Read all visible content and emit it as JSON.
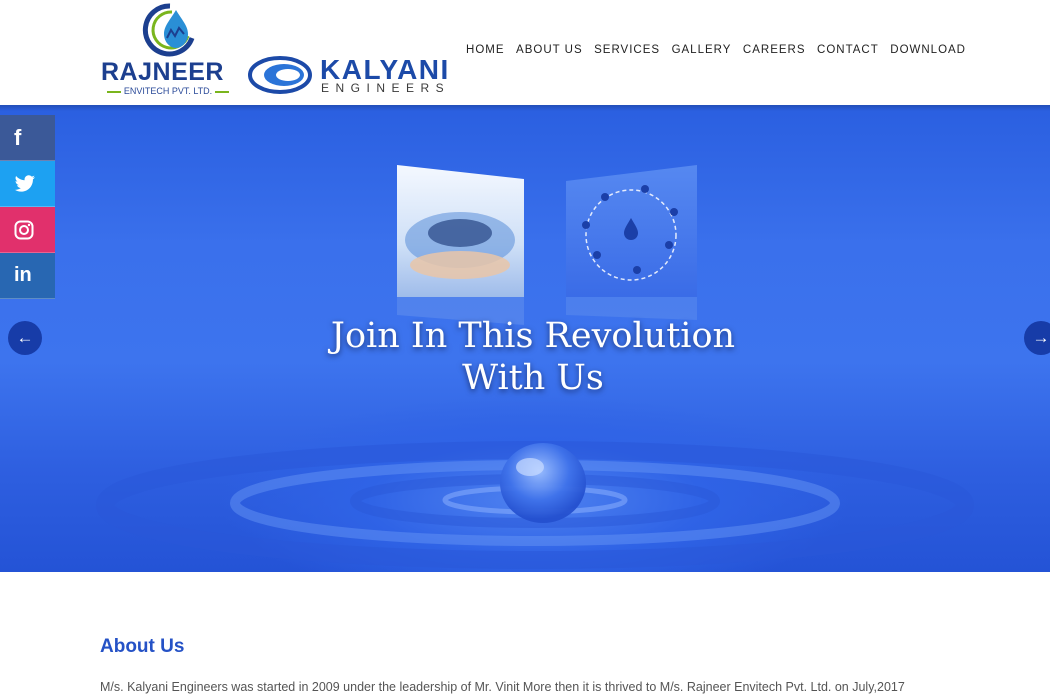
{
  "header": {
    "logo1": {
      "name": "RAJNEER",
      "sub": "ENVITECH PVT. LTD."
    },
    "logo2": {
      "name": "KALYANI",
      "sub": "ENGINEERS"
    },
    "nav": [
      "HOME",
      "ABOUT US",
      "SERVICES",
      "GALLERY",
      "CAREERS",
      "CONTACT",
      "DOWNLOAD"
    ]
  },
  "hero": {
    "title_line1": "Join In This Revolution",
    "title_line2": "With Us",
    "prev_icon": "arrow-left-icon",
    "next_icon": "arrow-right-icon"
  },
  "social": [
    "facebook-icon",
    "twitter-icon",
    "instagram-icon",
    "linkedin-icon"
  ],
  "about": {
    "title": "About Us",
    "text": "M/s. Kalyani Engineers was started in 2009 under the leadership of Mr. Vinit More then it is thrived to M/s. Rajneer Envitech Pvt. Ltd. on July,2017"
  },
  "colors": {
    "brand_blue": "#2552c6",
    "hero_blue": "#3a70ec",
    "facebook": "#3b5998",
    "twitter": "#1da1f2",
    "instagram": "#e1306c",
    "linkedin": "#2867b2"
  }
}
